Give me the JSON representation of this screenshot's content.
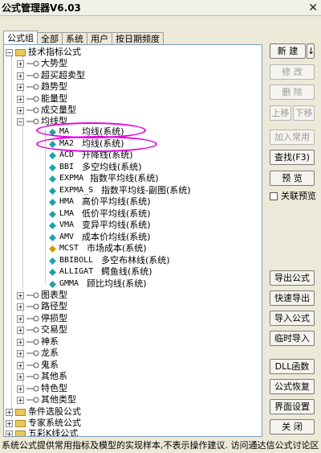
{
  "window": {
    "title": "公式管理器V6.03"
  },
  "tabs": [
    "公式组",
    "全部",
    "系统",
    "用户",
    "按日期频度"
  ],
  "tree": {
    "root_label": "技术指标公式",
    "groups": [
      "大势型",
      "超买超卖型",
      "趋势型",
      "能量型",
      "成交量型",
      "均线型"
    ],
    "ma_items": [
      {
        "code": "MA",
        "name": "均线(系统)"
      },
      {
        "code": "MA2",
        "name": "均线(系统)"
      },
      {
        "code": "ACD",
        "name": "升降线(系统)"
      },
      {
        "code": "BBI",
        "name": "多空均线(系统)"
      },
      {
        "code": "EXPMA",
        "name": "指数平均线(系统)"
      },
      {
        "code": "EXPMA_S",
        "name": "指数平均线-副图(系统)"
      },
      {
        "code": "HMA",
        "name": "高价平均线(系统)"
      },
      {
        "code": "LMA",
        "name": "低价平均线(系统)"
      },
      {
        "code": "VMA",
        "name": "变异平均线(系统)"
      },
      {
        "code": "AMV",
        "name": "成本价均线(系统)"
      },
      {
        "code": "MCST",
        "name": "市场成本(系统)"
      },
      {
        "code": "BBIBOLL",
        "name": "多空布林线(系统)"
      },
      {
        "code": "ALLIGAT",
        "name": "鳄鱼线(系统)"
      },
      {
        "code": "GMMA",
        "name": "顾比均线(系统)"
      }
    ],
    "more_groups": [
      "图表型",
      "路径型",
      "停损型",
      "交易型",
      "神系",
      "龙系",
      "鬼系",
      "其他系",
      "特色型",
      "其他类型"
    ],
    "root_folders": [
      "条件选股公式",
      "专家系统公式",
      "五彩K线公式"
    ]
  },
  "buttons": {
    "new": "新 建",
    "new_arrow": "↓",
    "modify": "修 改",
    "delete": "删 除",
    "move_up": "上移",
    "move_down": "下移",
    "add_common": "加入常用",
    "find": "查找(F3)",
    "preview": "预 览",
    "linked_preview": "关联预览",
    "export": "导出公式",
    "quick_export": "快速导出",
    "import": "导入公式",
    "temp_import": "临时导入",
    "dll": "DLL函数",
    "restore": "公式恢复",
    "ui_settings": "界面设置",
    "close": "关 闭"
  },
  "status": {
    "text": "系统公式提供常用指标及模型的实现样本,不表示操作建议. 访问通达信公式讨论区"
  },
  "colors": {
    "highlight": "#e400e4",
    "tree_border": "#7f9db9",
    "leaf_icon": "#1ea2a8",
    "leaf_icon_alt": "#c8a000"
  }
}
